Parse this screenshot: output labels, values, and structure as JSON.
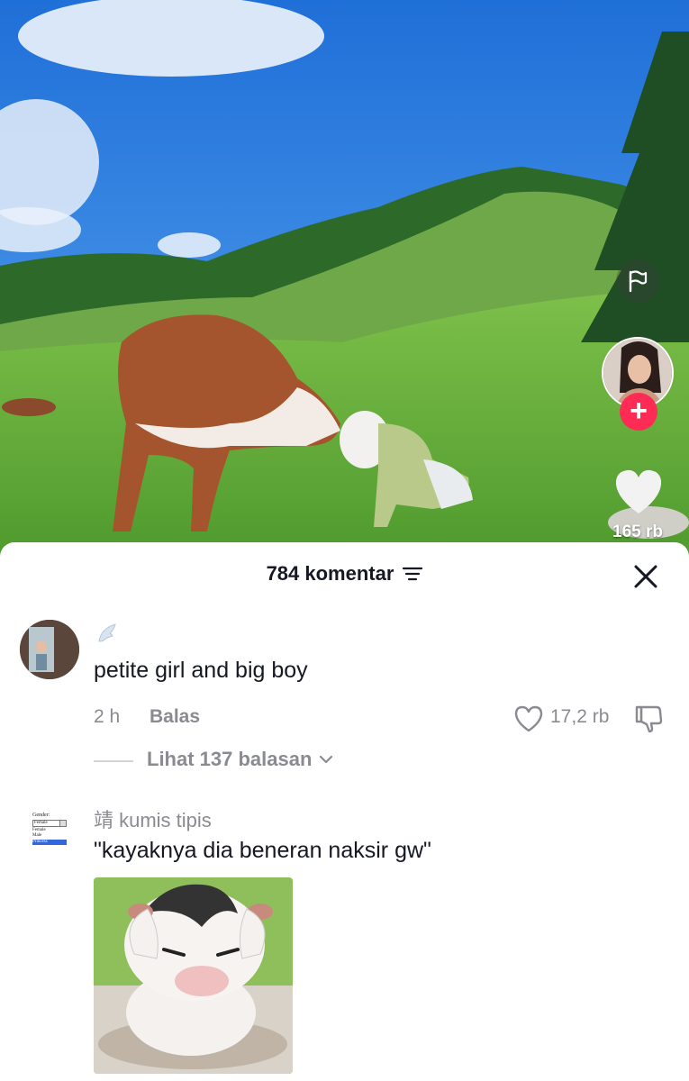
{
  "video": {
    "like_count": "165 rb"
  },
  "comments_sheet": {
    "title": "784 komentar"
  },
  "comments": [
    {
      "username": "",
      "text": "petite girl and big boy",
      "time": "2 h",
      "reply_label": "Balas",
      "like_count": "17,2 rb",
      "view_replies": "Lihat 137 balasan"
    },
    {
      "username": "靖 kumis tipis",
      "text": "\"kayaknya dia beneran naksir gw\"",
      "avatar_form": {
        "label": "Gender:",
        "selected": "Female",
        "options": [
          "Female",
          "Male",
          "Princess"
        ]
      }
    }
  ],
  "colors": {
    "accent": "#fe2c55",
    "text_primary": "#161823",
    "text_secondary": "#8a8b91",
    "sky": "#2f7fe0",
    "grass": "#5fa83a"
  },
  "icons": {
    "flag": "flag-icon",
    "follow": "plus-icon",
    "like": "heart-icon",
    "filter": "filter-icon",
    "close": "close-icon",
    "dislike": "thumbs-down-icon",
    "chevron": "chevron-down-icon"
  }
}
